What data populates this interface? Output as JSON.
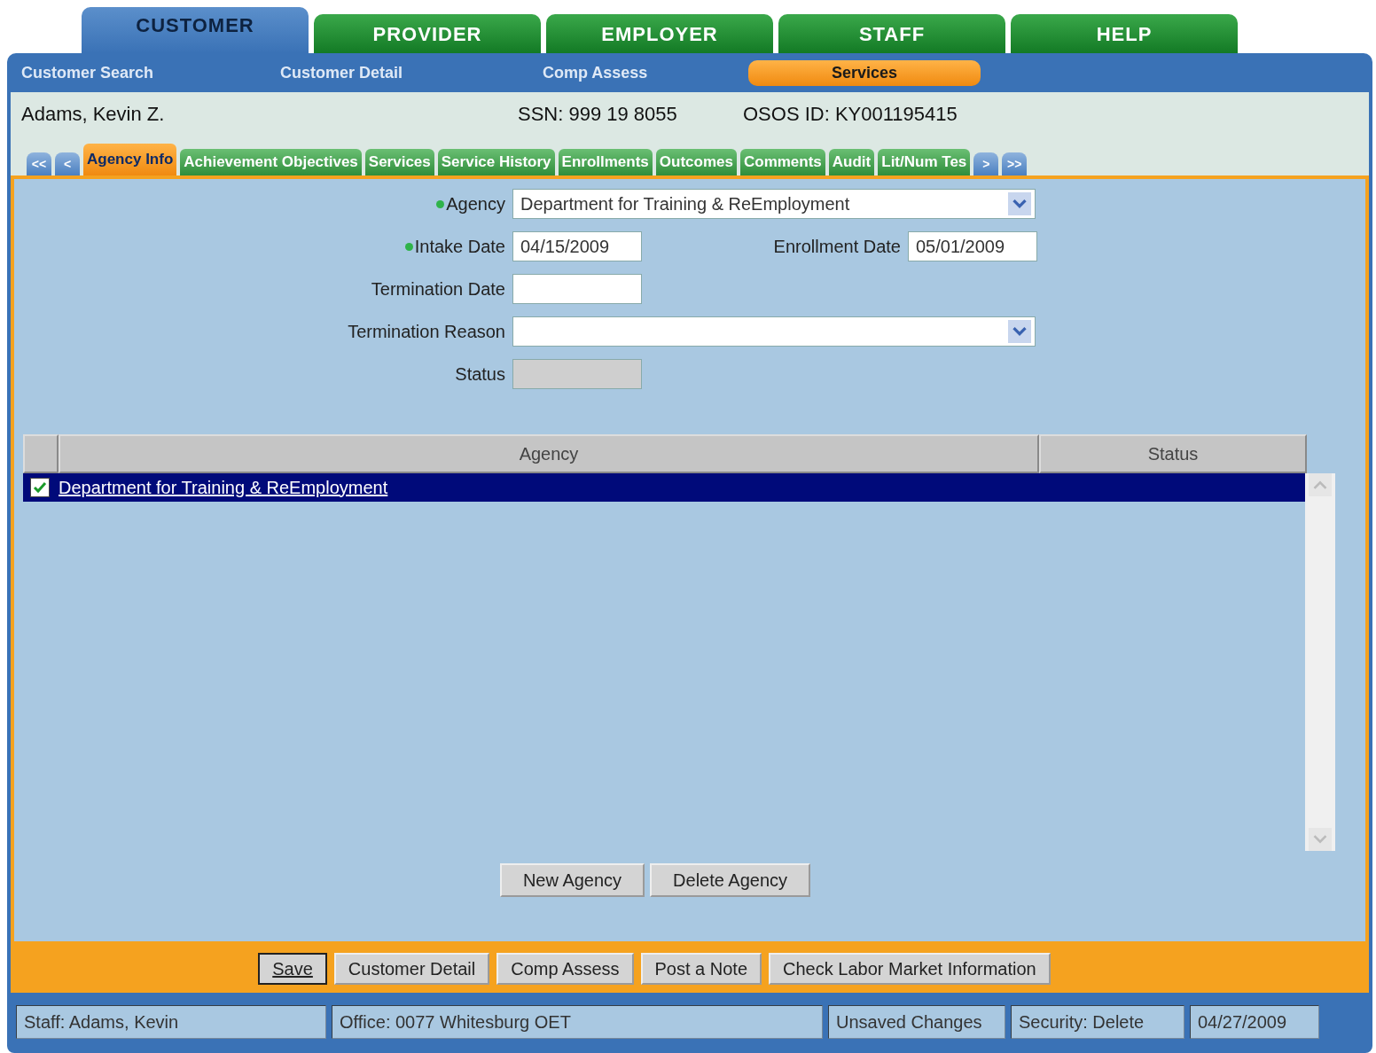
{
  "main_tabs": [
    {
      "label": "CUSTOMER",
      "selected": true
    },
    {
      "label": "PROVIDER",
      "selected": false
    },
    {
      "label": "EMPLOYER",
      "selected": false
    },
    {
      "label": "STAFF",
      "selected": false
    },
    {
      "label": "HELP",
      "selected": false
    }
  ],
  "sub_nav": [
    {
      "label": "Customer Search",
      "selected": false
    },
    {
      "label": "Customer Detail",
      "selected": false
    },
    {
      "label": "Comp Assess",
      "selected": false
    },
    {
      "label": "Services",
      "selected": true
    }
  ],
  "customer": {
    "name": "Adams, Kevin Z.",
    "ssn": "SSN: 999 19 8055",
    "osos_id": "OSOS ID: KY001195415"
  },
  "nav_first": "<<",
  "nav_prev": "<",
  "nav_next": ">",
  "nav_last": ">>",
  "section_tabs": [
    {
      "label": "Agency Info",
      "selected": true
    },
    {
      "label": "Achievement Objectives",
      "selected": false
    },
    {
      "label": "Services",
      "selected": false
    },
    {
      "label": "Service History",
      "selected": false
    },
    {
      "label": "Enrollments",
      "selected": false
    },
    {
      "label": "Outcomes",
      "selected": false
    },
    {
      "label": "Comments",
      "selected": false
    },
    {
      "label": "Audit",
      "selected": false
    },
    {
      "label": "Lit/Num Tes",
      "selected": false
    }
  ],
  "form_rows": [
    {
      "fields": [
        {
          "label": "Agency",
          "required": true,
          "kind": "select",
          "value": "Department for Training & ReEmployment"
        }
      ]
    },
    {
      "fields": [
        {
          "label": "Intake Date",
          "required": true,
          "kind": "text",
          "value": "04/15/2009"
        },
        {
          "label": "Enrollment Date",
          "required": false,
          "kind": "text",
          "value": "05/01/2009"
        }
      ]
    },
    {
      "fields": [
        {
          "label": "Termination Date",
          "required": false,
          "kind": "text"
        }
      ]
    },
    {
      "fields": [
        {
          "label": "Termination Reason",
          "required": false,
          "kind": "select"
        }
      ]
    },
    {
      "fields": [
        {
          "label": "Status",
          "required": false,
          "kind": "readonly"
        }
      ]
    }
  ],
  "table": {
    "columns": [
      "Agency",
      "Status"
    ],
    "rows": [
      {
        "checked": true,
        "selected": true,
        "agency": "Department for Training & ReEmployment"
      }
    ]
  },
  "table_buttons": [
    "New Agency",
    "Delete Agency"
  ],
  "action_buttons": [
    {
      "label": "Save",
      "selected": true
    },
    {
      "label": "Customer Detail",
      "selected": false
    },
    {
      "label": "Comp Assess",
      "selected": false
    },
    {
      "label": "Post a Note",
      "selected": false
    },
    {
      "label": "Check Labor Market Information",
      "selected": false
    }
  ],
  "status_bar": [
    "Staff: Adams, Kevin",
    "Office: 0077 Whitesburg OET",
    "Unsaved Changes",
    "Security: Delete",
    "04/27/2009"
  ]
}
